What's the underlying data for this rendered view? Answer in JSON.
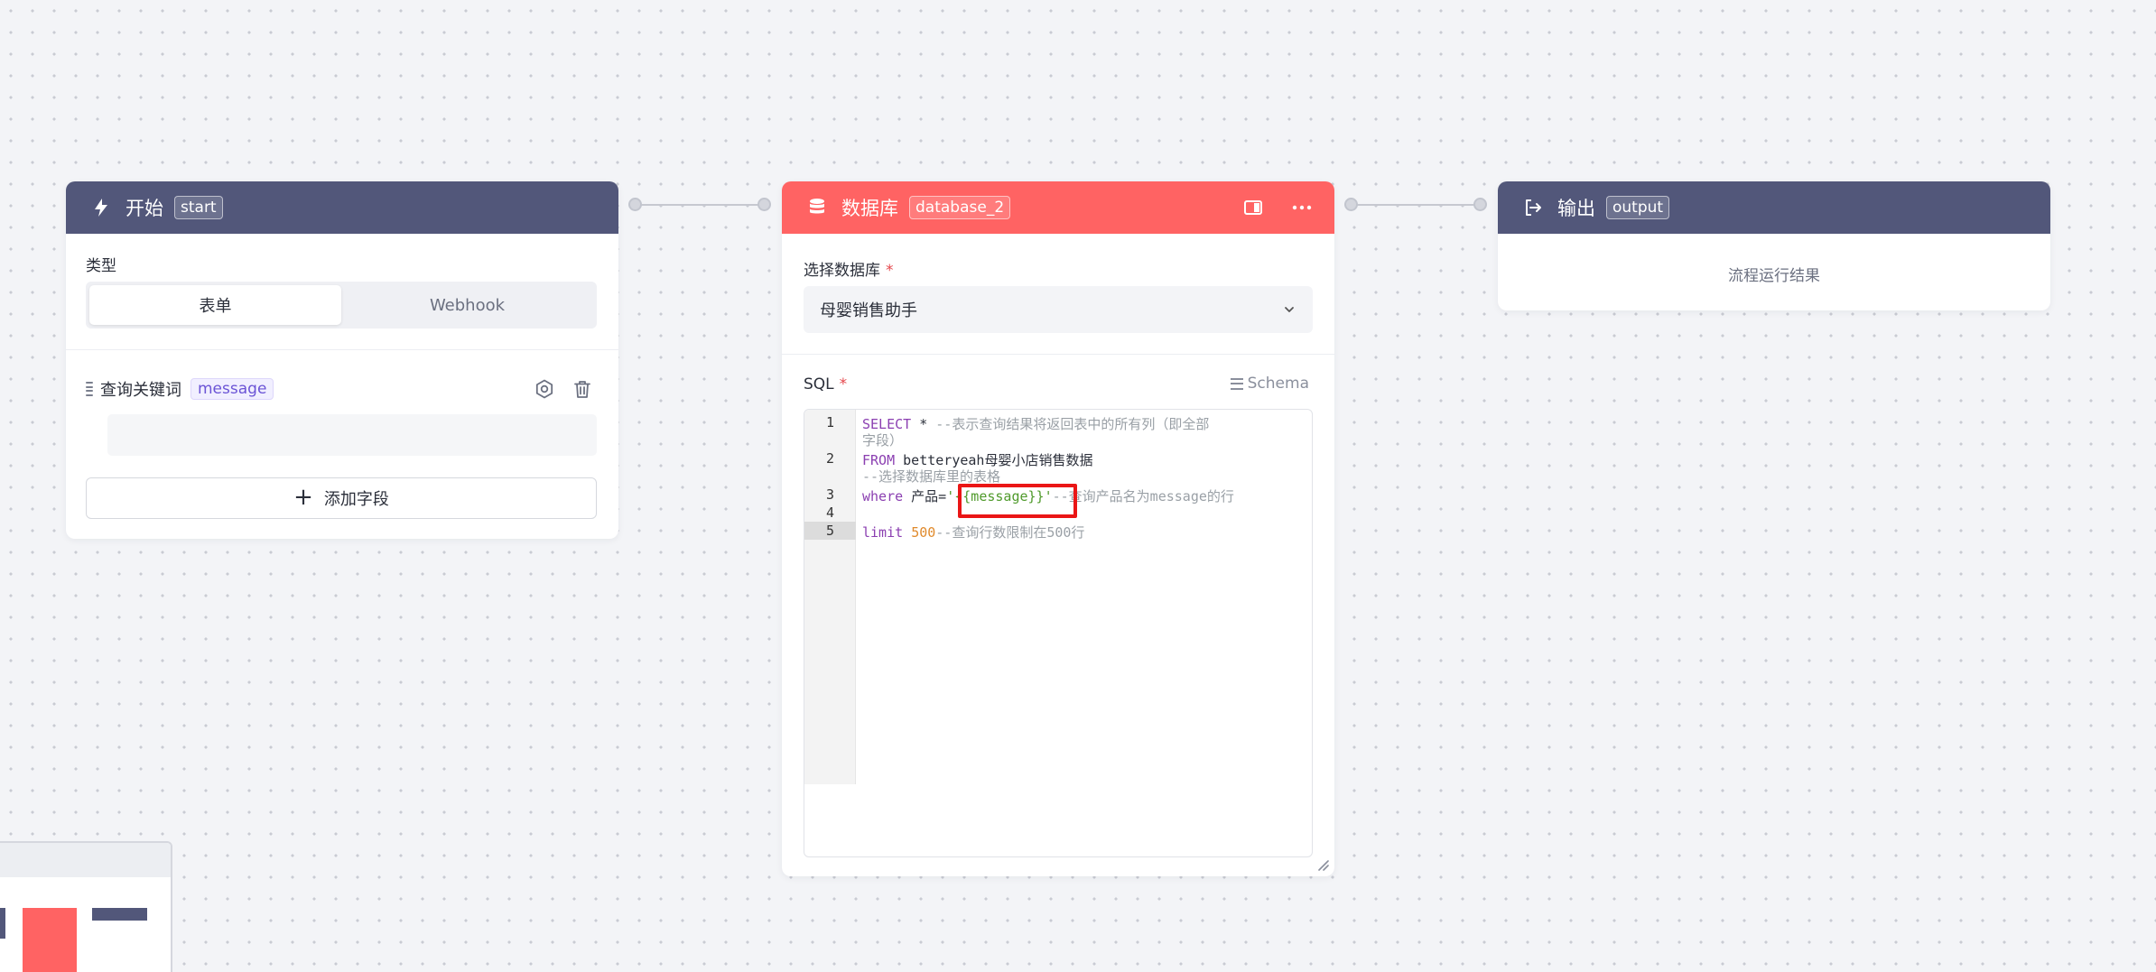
{
  "colors": {
    "start_header": "#52577a",
    "db_header": "#ff6363",
    "output_header": "#52577a",
    "variable_tag": "#6b54d6",
    "highlight": "#ea1616"
  },
  "start_node": {
    "icon": "lightning-icon",
    "title": "开始",
    "id": "start",
    "type_label": "类型",
    "tabs": [
      {
        "label": "表单",
        "active": true
      },
      {
        "label": "Webhook",
        "active": false
      }
    ],
    "field": {
      "name": "查询关键词",
      "variable": "message",
      "value": ""
    },
    "add_field_label": "添加字段"
  },
  "db_node": {
    "icon": "database-icon",
    "title": "数据库",
    "id": "database_2",
    "select_label": "选择数据库",
    "selected_db": "母婴销售助手",
    "sql_label": "SQL",
    "schema_label": "Schema",
    "sql_lines": {
      "l1": {
        "num": "1",
        "kw": "SELECT",
        "rest": " * ",
        "comment": "--表示查询结果将返回表中的所有列（即全部",
        "comment_wrap": "字段）"
      },
      "l2": {
        "num": "2",
        "kw": "FROM",
        "rest": " betteryeah母婴小店销售数据",
        "comment_wrap": "--选择数据库里的表格"
      },
      "l3": {
        "num": "3",
        "kw": "where",
        "rest": " 产品=",
        "string": "'{{message}}'",
        "comment": "--查询产品名为message的行"
      },
      "l4": {
        "num": "4"
      },
      "l5": {
        "num": "5",
        "kw": "limit",
        "number": "500",
        "comment": "--查询行数限制在500行"
      }
    }
  },
  "output_node": {
    "icon": "exit-icon",
    "title": "输出",
    "id": "output",
    "result_text": "流程运行结果"
  }
}
